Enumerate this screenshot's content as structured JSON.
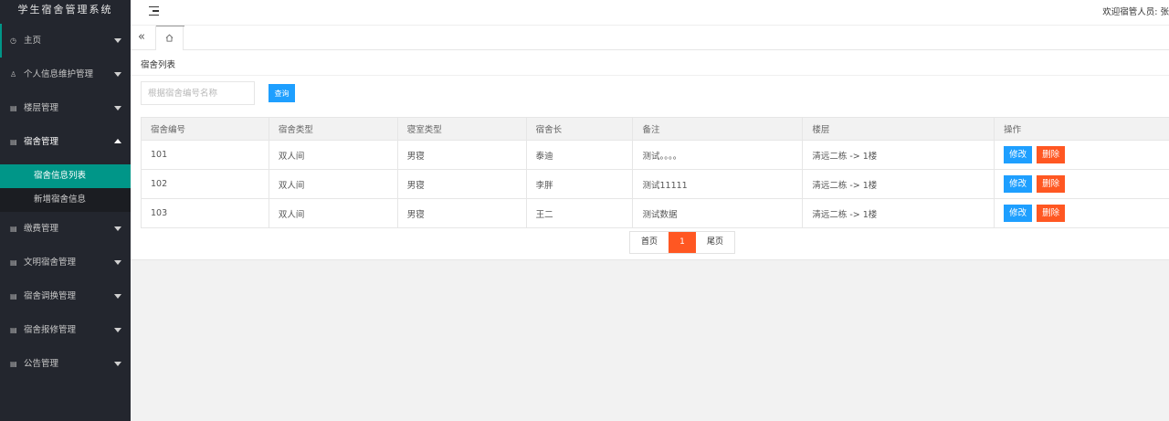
{
  "app": {
    "title": "学生宿舍管理系统"
  },
  "header": {
    "welcome": "欢迎宿管人员: 张"
  },
  "sidebar": {
    "items": [
      {
        "label": "主页",
        "icon": "dashboard-icon"
      },
      {
        "label": "个人信息维护管理",
        "icon": "user-icon"
      },
      {
        "label": "楼层管理",
        "icon": "doc-icon"
      },
      {
        "label": "宿舍管理",
        "icon": "doc-icon",
        "open": true,
        "children": [
          {
            "label": "宿舍信息列表",
            "active": true
          },
          {
            "label": "新增宿舍信息"
          }
        ]
      },
      {
        "label": "缴费管理",
        "icon": "doc-icon"
      },
      {
        "label": "文明宿舍管理",
        "icon": "doc-icon"
      },
      {
        "label": "宿舍调换管理",
        "icon": "doc-icon"
      },
      {
        "label": "宿舍报修管理",
        "icon": "doc-icon"
      },
      {
        "label": "公告管理",
        "icon": "doc-icon"
      }
    ]
  },
  "tabs": {
    "collapse": "«",
    "home_icon": "home-icon"
  },
  "page": {
    "breadcrumb": "宿舍列表",
    "search": {
      "placeholder": "根据宿舍编号名称",
      "button": "查询"
    }
  },
  "table": {
    "headers": [
      "宿舍编号",
      "宿舍类型",
      "寝室类型",
      "宿舍长",
      "备注",
      "楼层",
      "操作"
    ],
    "rows": [
      [
        "101",
        "双人间",
        "男寝",
        "泰迪",
        "测试。。。。",
        "清远二栋 -> 1楼"
      ],
      [
        "102",
        "双人间",
        "男寝",
        "李胖",
        "测试11111",
        "清远二栋 -> 1楼"
      ],
      [
        "103",
        "双人间",
        "男寝",
        "王二",
        "测试数据",
        "清远二栋 -> 1楼"
      ]
    ],
    "actions": {
      "edit": "修改",
      "delete": "删除"
    }
  },
  "pager": {
    "first": "首页",
    "current": "1",
    "last": "尾页"
  },
  "colors": {
    "sidebar_bg": "#23262e",
    "accent_teal": "#009688",
    "btn_blue": "#1e9fff",
    "btn_orange": "#ff5722"
  }
}
